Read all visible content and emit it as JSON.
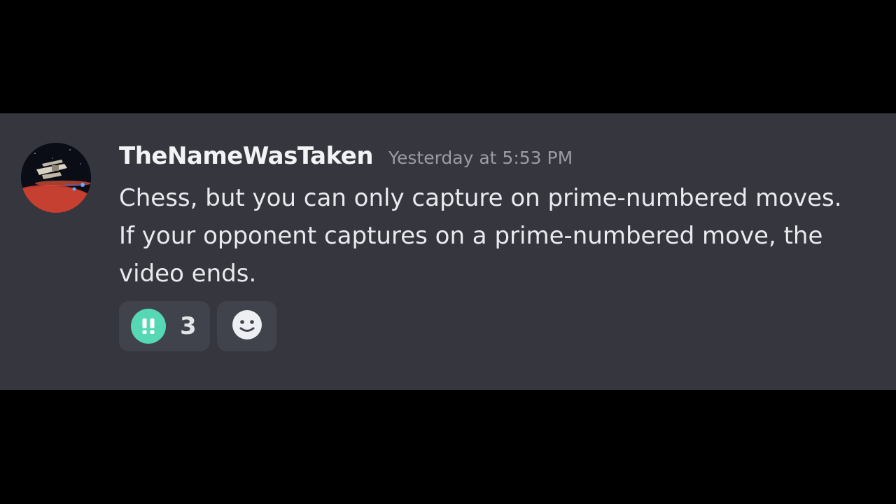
{
  "message": {
    "username": "TheNameWasTaken",
    "timestamp": "Yesterday at 5:53 PM",
    "content": "Chess, but you can only capture on prime-numbered moves. If your opponent captures on a prime-numbered move, the video ends."
  },
  "reactions": [
    {
      "emoji": "double-exclamation-icon",
      "count": "3",
      "color": "#56d8b4"
    }
  ],
  "add_reaction_icon": "smiley-face-icon",
  "colors": {
    "background_band": "#36363f",
    "letterbox": "#000000",
    "reaction_bg": "#41434c"
  }
}
